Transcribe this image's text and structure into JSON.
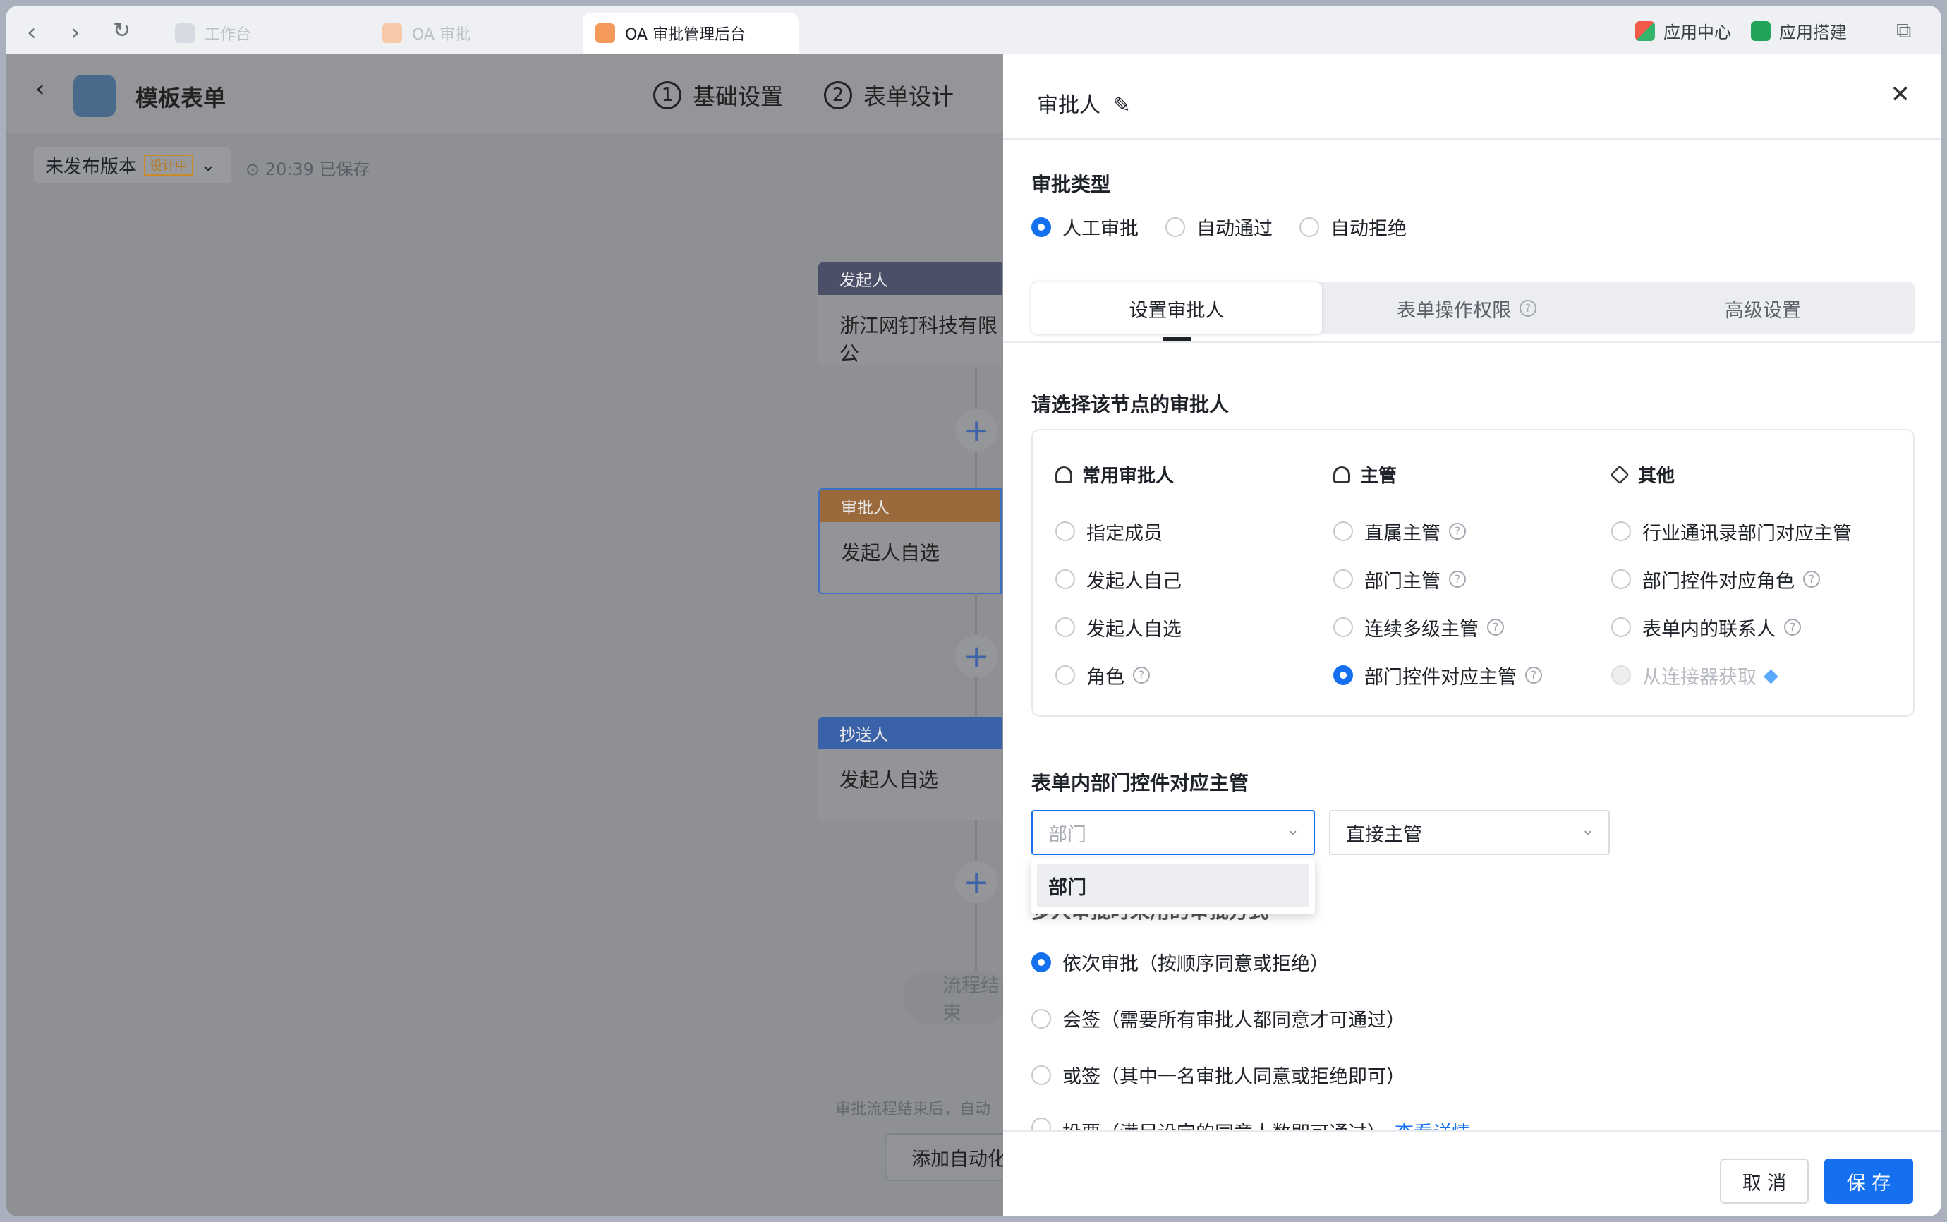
{
  "browser": {
    "tabs": [
      "工作台",
      "OA 审批",
      "OA 审批管理后台"
    ],
    "app_center": "应用中心",
    "app_build": "应用搭建"
  },
  "editor": {
    "title": "模板表单",
    "steps": [
      {
        "num": "1",
        "label": "基础设置"
      },
      {
        "num": "2",
        "label": "表单设计"
      }
    ],
    "version": "未发布版本",
    "badge": "设计中",
    "saved": "20:39 已保存"
  },
  "flow": {
    "initiator_header": "发起人",
    "initiator_body": "浙江网钉科技有限公",
    "approver_header": "审批人",
    "approver_body": "发起人自选",
    "cc_header": "抄送人",
    "cc_body": "发起人自选",
    "end": "流程结束",
    "hint": "审批流程结束后，自动",
    "auto_btn": "添加自动化"
  },
  "panel": {
    "title": "审批人",
    "type_label": "审批类型",
    "types": [
      "人工审批",
      "自动通过",
      "自动拒绝"
    ],
    "tabs": [
      "设置审批人",
      "表单操作权限",
      "高级设置"
    ],
    "choose_label": "请选择该节点的审批人",
    "cols": [
      {
        "title": "常用审批人",
        "items": [
          "指定成员",
          "发起人自己",
          "发起人自选",
          "角色"
        ]
      },
      {
        "title": "主管",
        "items": [
          "直属主管",
          "部门主管",
          "连续多级主管",
          "部门控件对应主管"
        ]
      },
      {
        "title": "其他",
        "items": [
          "行业通讯录部门对应主管",
          "部门控件对应角色",
          "表单内的联系人",
          "从连接器获取"
        ]
      }
    ],
    "dept_label": "表单内部门控件对应主管",
    "dept_placeholder": "部门",
    "manager_value": "直接主管",
    "dropdown_option": "部门",
    "multi_label": "多人审批时采用的审批方式",
    "methods": [
      "依次审批（按顺序同意或拒绝）",
      "会签（需要所有审批人都同意才可通过）",
      "或签（其中一名审批人同意或拒绝即可）",
      "投票（满足设定的同意人数即可通过）"
    ],
    "details": "查看详情",
    "cancel": "取 消",
    "save": "保 存"
  }
}
